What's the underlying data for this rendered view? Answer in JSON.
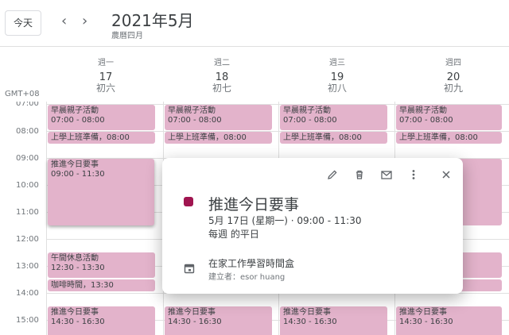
{
  "header": {
    "today_label": "今天",
    "prev_icon": "chevron-left",
    "next_icon": "chevron-right",
    "title": "2021年5月",
    "subtitle": "農曆四月"
  },
  "timezone": "GMT+08",
  "days": [
    {
      "weekday": "週一",
      "date": "17",
      "lunar": "初六"
    },
    {
      "weekday": "週二",
      "date": "18",
      "lunar": "初七"
    },
    {
      "weekday": "週三",
      "date": "19",
      "lunar": "初八"
    },
    {
      "weekday": "週四",
      "date": "20",
      "lunar": "初九"
    }
  ],
  "hours": [
    "07:00",
    "08:00",
    "09:00",
    "10:00",
    "11:00",
    "12:00",
    "13:00",
    "14:00",
    "15:00"
  ],
  "events": {
    "early_title": "早晨親子活動",
    "early_time": "07:00 - 08:00",
    "prep": "上學上班準備，08:00",
    "promote_title": "推進今日要事",
    "promote_time": "09:00 - 11:30",
    "lunch_title": "午間休息活動",
    "lunch_time": "12:30 - 13:30",
    "coffee": "咖啡時間，13:30",
    "afternoon_title": "推進今日要事",
    "afternoon_time": "14:30 - 16:30"
  },
  "popup": {
    "title": "推進今日要事",
    "date_time": "5月 17日 (星期一)  ·  09:00 - 11:30",
    "repeat": "每週 的平日",
    "calendar": "在家工作學習時間盒",
    "creator": "建立者：esor huang",
    "color": "#a01550",
    "icons": [
      "edit-icon",
      "delete-icon",
      "email-icon",
      "more-icon",
      "close-icon"
    ]
  },
  "colors": {
    "event": "#e3b3cb",
    "accent": "#a01550"
  }
}
